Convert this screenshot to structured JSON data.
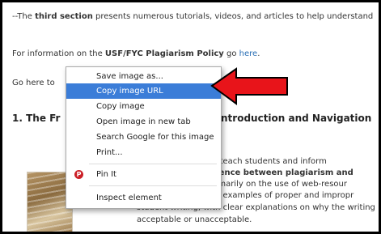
{
  "content": {
    "line1_prefix": "--The ",
    "line1_bold": "third section",
    "line1_suffix": " presents numerous tutorials, videos, and articles to help understand",
    "line2_prefix": "For information on the ",
    "line2_bold": "USF/FYC Plagiarism Policy",
    "line2_mid": " go ",
    "line2_link": "here",
    "line2_end": ".",
    "line3": "Go here to",
    "heading_left": "1. The Fr",
    "heading_right": "ntroduction and Navigation",
    "body": {
      "line1": "gned to teach students and inform",
      "line2": "e difference between plagiarism and",
      "line3": "uses primarily on the use of web-resour",
      "line4": "contains examples of proper and impropr",
      "line5": "student writing, with clear explanations on why the writing is",
      "line6": "acceptable or unacceptable."
    }
  },
  "context_menu": {
    "items": [
      "Save image as...",
      "Copy image URL",
      "Copy image",
      "Open image in new tab",
      "Search Google for this image",
      "Print...",
      "Pin It",
      "Inspect element"
    ],
    "highlighted_item": "Copy image URL",
    "highlight_color": "#3b7dd8"
  },
  "annotation": {
    "arrow_color": "#e8141a",
    "arrow_icon": "red-arrow-left"
  },
  "icons": {
    "pin_it_icon": "pinterest-icon",
    "pin_it_color": "#cb2027"
  }
}
